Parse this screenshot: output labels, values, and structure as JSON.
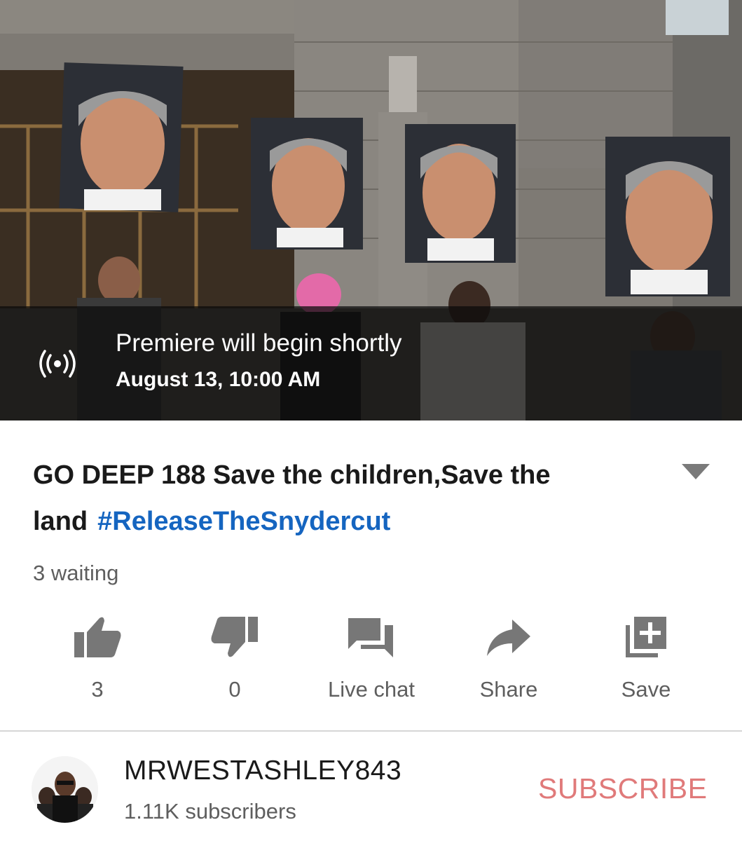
{
  "video": {
    "premiere_title": "Premiere will begin shortly",
    "premiere_date": "August 13, 10:00 AM",
    "premiere_icon": "live-broadcast-icon"
  },
  "title": {
    "text": "GO DEEP 188 Save the children,Save the land",
    "hashtag": "#ReleaseTheSnydercut"
  },
  "waiting": "3 waiting",
  "actions": [
    {
      "icon": "thumbs-up-icon",
      "label": "3"
    },
    {
      "icon": "thumbs-down-icon",
      "label": "0"
    },
    {
      "icon": "chat-icon",
      "label": "Live chat"
    },
    {
      "icon": "share-icon",
      "label": "Share"
    },
    {
      "icon": "playlist-add-icon",
      "label": "Save"
    }
  ],
  "channel": {
    "name": "MRWESTASHLEY843",
    "subscribers": "1.11K subscribers",
    "subscribe_label": "SUBSCRIBE"
  },
  "colors": {
    "hashtag": "#1565c0",
    "subscribe": "#e07a7a",
    "secondary_text": "#5e5e5e"
  }
}
